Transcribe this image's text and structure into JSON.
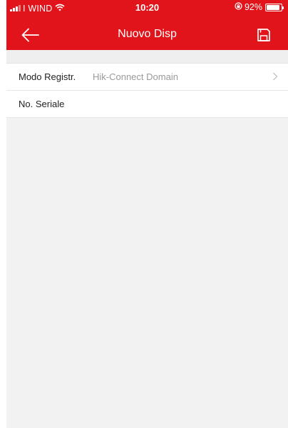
{
  "status_bar": {
    "carrier": "I WIND",
    "time": "10:20",
    "battery": "92%",
    "battery_level": 0.92
  },
  "navbar": {
    "title": "Nuovo Disp",
    "back_icon": "arrow-left-icon",
    "save_icon": "floppy-disk-icon"
  },
  "form": {
    "rows": [
      {
        "label": "Modo Registr.",
        "value": "Hik-Connect Domain",
        "icon": "chevron-right-icon"
      },
      {
        "label": "No. Seriale",
        "value": ""
      }
    ]
  },
  "colors": {
    "accent": "#e2141b",
    "background": "#f2f2f2"
  }
}
